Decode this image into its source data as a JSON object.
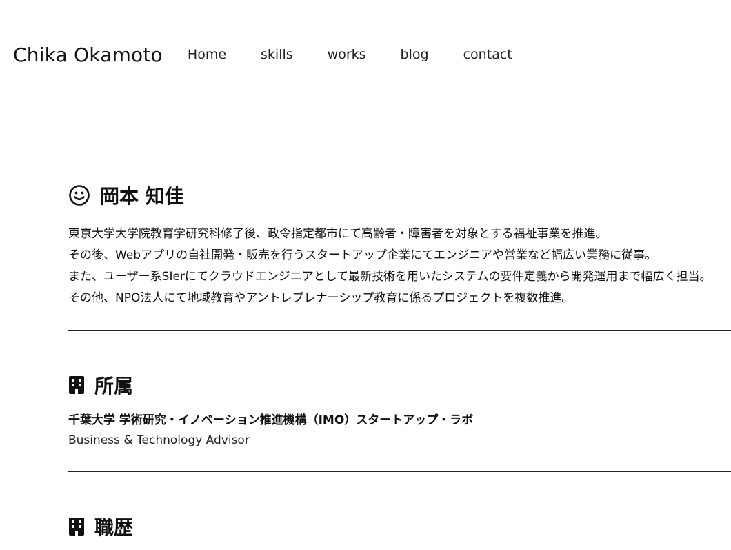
{
  "header": {
    "brand": "Chika Okamoto",
    "nav": [
      {
        "label": "Home"
      },
      {
        "label": "skills"
      },
      {
        "label": "works"
      },
      {
        "label": "blog"
      },
      {
        "label": "contact"
      }
    ]
  },
  "profile": {
    "icon": "smiley-icon",
    "name": "岡本 知佳",
    "lines": [
      "東京大学大学院教育学研究科修了後、政令指定都市にて高齢者・障害者を対象とする福祉事業を推進。",
      "その後、Webアプリの自社開発・販売を行うスタートアップ企業にてエンジニアや営業など幅広い業務に従事。",
      "また、ユーザー系SIerにてクラウドエンジニアとして最新技術を用いたシステムの要件定義から開発運用まで幅広く担当。",
      "その他、NPO法人にて地域教育やアントレプレナーシップ教育に係るプロジェクトを複数推進。"
    ]
  },
  "affiliation": {
    "icon": "building-icon",
    "title": "所属",
    "organization": "千葉大学 学術研究・イノベーション推進機構（IMO）スタートアップ・ラボ",
    "role": "Business & Technology Advisor"
  },
  "career": {
    "icon": "building-icon",
    "title": "職歴"
  }
}
